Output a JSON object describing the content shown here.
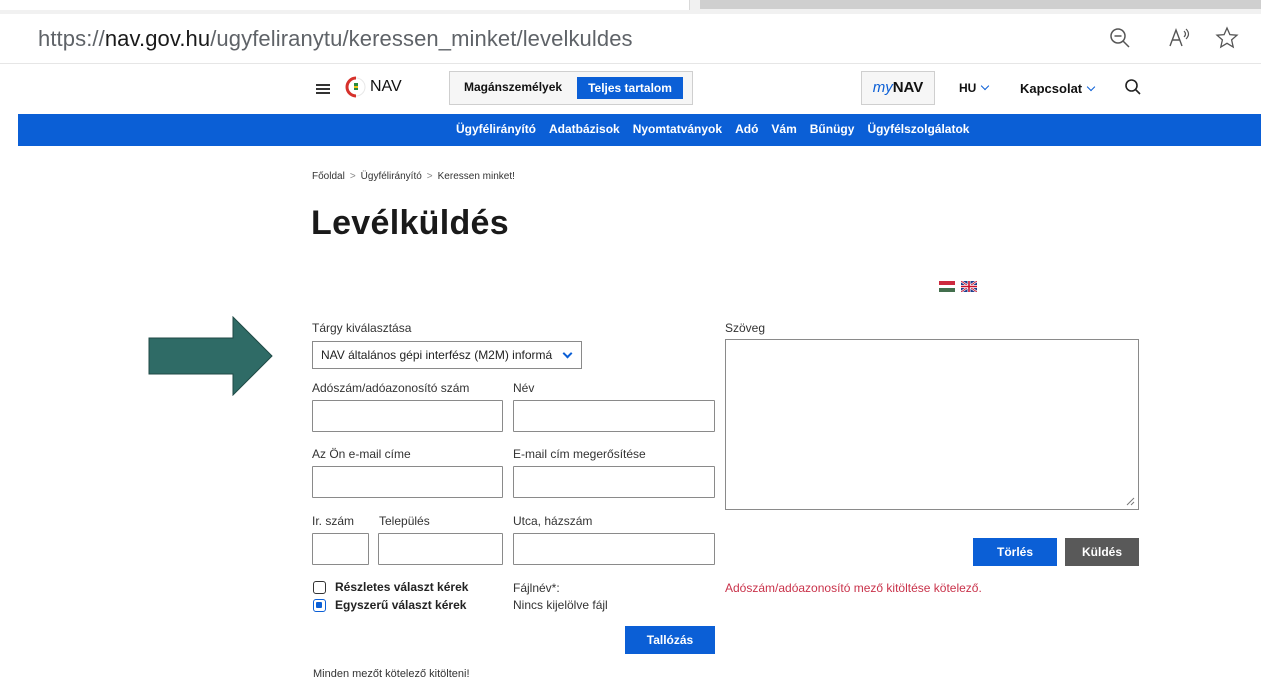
{
  "browser": {
    "url_scheme": "https://",
    "url_host": "nav.gov.hu",
    "url_path": "/ugyfeliranytu/keressen_minket/levelkuldes",
    "icons": [
      "zoom-out-icon",
      "read-aloud-icon",
      "favorite-star-icon"
    ]
  },
  "header": {
    "logo_text": "NAV",
    "segment_private": "Magánszemélyek",
    "segment_full": "Teljes tartalom",
    "mynav_prefix": "my",
    "mynav_suffix": "NAV",
    "language": "HU",
    "contact": "Kapcsolat"
  },
  "nav": {
    "items": [
      "Ügyfélirányító",
      "Adatbázisok",
      "Nyomtatványok",
      "Adó",
      "Vám",
      "Bűnügy",
      "Ügyfélszolgálatok"
    ]
  },
  "breadcrumb": [
    "Főoldal",
    "Ügyfélirányító",
    "Keressen minket!"
  ],
  "page_title": "Levélküldés",
  "form": {
    "subject_label": "Tárgy kiválasztása",
    "subject_value": "NAV általános gépi interfész (M2M) informá",
    "tax_id_label": "Adószám/adóazonosító szám",
    "name_label": "Név",
    "email_label": "Az Ön e-mail címe",
    "email_confirm_label": "E-mail cím megerősítése",
    "zip_label": "Ir. szám",
    "city_label": "Település",
    "street_label": "Utca, házszám",
    "text_label": "Szöveg",
    "detailed_reply": "Részletes választ kérek",
    "simple_reply": "Egyszerű választ kérek",
    "simple_reply_checked": true,
    "detailed_reply_checked": false,
    "file_label": "Fájlnév*:",
    "file_value": "Nincs kijelölve fájl",
    "browse_button": "Tallózás",
    "clear_button": "Törlés",
    "send_button": "Küldés",
    "error_message": "Adószám/adóazonosító mező kitöltése kötelező.",
    "required_note": "Minden mezőt kötelező kitölteni!"
  },
  "colors": {
    "primary": "#0b5fd6",
    "error": "#c9324a",
    "annotation_arrow": "#2f6b66"
  }
}
